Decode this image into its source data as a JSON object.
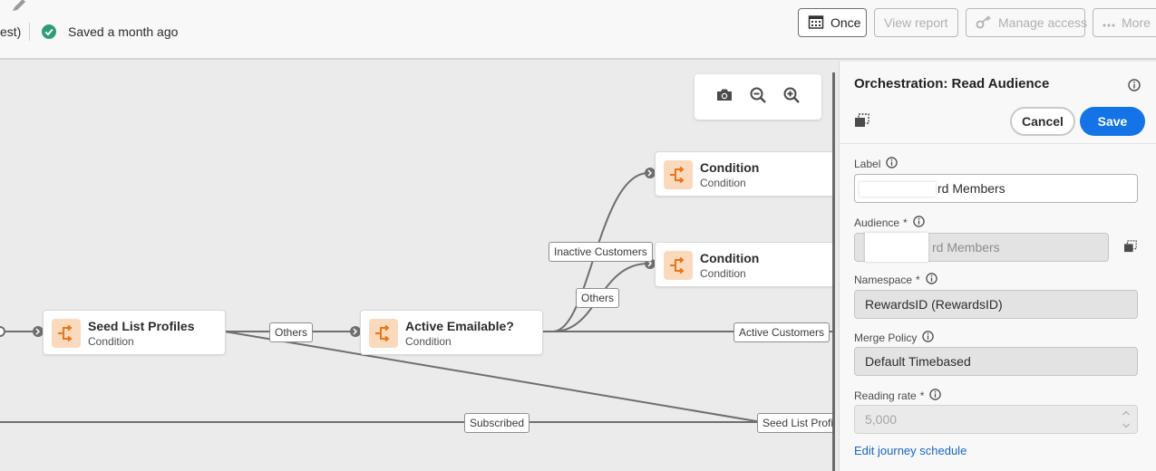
{
  "header": {
    "breadcrumb_fragment": "est)",
    "saved_status": "Saved a month ago",
    "buttons": {
      "once": "Once",
      "view_report": "View report",
      "manage_access": "Manage access",
      "more": "More"
    }
  },
  "canvas": {
    "nodes": [
      {
        "title": "Seed List Profiles",
        "subtitle": "Condition"
      },
      {
        "title": "Active Emailable?",
        "subtitle": "Condition"
      },
      {
        "title": "Condition",
        "subtitle": "Condition"
      },
      {
        "title": "Condition",
        "subtitle": "Condition"
      }
    ],
    "edge_labels": {
      "others_1": "Others",
      "inactive_customers": "Inactive Customers",
      "others_2": "Others",
      "active_customers": "Active Customers",
      "subscribed": "Subscribed",
      "seed_list_profiles": "Seed List Profiles"
    }
  },
  "panel": {
    "title": "Orchestration: Read Audience",
    "cancel": "Cancel",
    "save": "Save",
    "fields": {
      "label": {
        "label": "Label",
        "value": "rd Members"
      },
      "audience": {
        "label": "Audience",
        "required": "*",
        "value": "rd Members"
      },
      "namespace": {
        "label": "Namespace",
        "required": "*",
        "value": "RewardsID (RewardsID)"
      },
      "merge_policy": {
        "label": "Merge Policy",
        "value": "Default Timebased"
      },
      "reading_rate": {
        "label": "Reading rate",
        "required": "*",
        "value": "5,000"
      }
    },
    "edit_link": "Edit journey schedule"
  },
  "colors": {
    "accent_blue": "#1473e6",
    "condition_icon_bg": "#fbd9bd",
    "condition_icon_fg": "#e8761a",
    "success_green": "#2d9d78"
  },
  "icons": [
    "pencil-icon",
    "check-circle-icon",
    "calendar-icon",
    "key-icon",
    "more-icon",
    "camera-icon",
    "zoom-out-icon",
    "zoom-in-icon",
    "condition-icon",
    "info-icon",
    "copy-icon",
    "stepper-icon"
  ]
}
